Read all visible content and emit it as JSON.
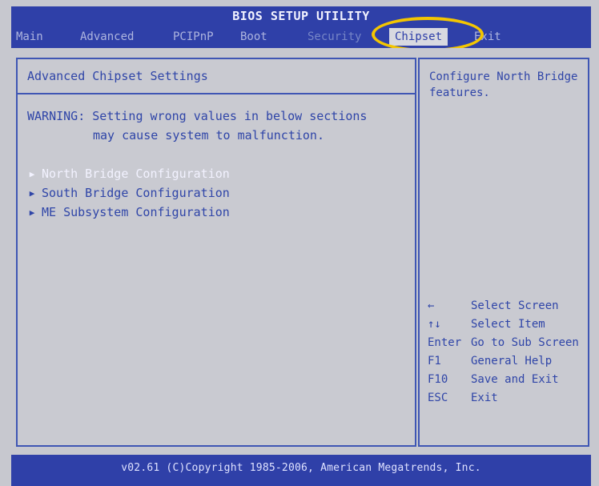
{
  "window": {
    "title": "BIOS SETUP UTILITY"
  },
  "menu": {
    "items": [
      {
        "label": "Main"
      },
      {
        "label": "Advanced"
      },
      {
        "label": "PCIPnP"
      },
      {
        "label": "Boot"
      },
      {
        "label": "Security"
      },
      {
        "label": "Chipset"
      },
      {
        "label": "Exit"
      }
    ],
    "active": "Chipset"
  },
  "main": {
    "section_title": "Advanced Chipset Settings",
    "warning_line1": "WARNING: Setting wrong values in below sections",
    "warning_line2": "may cause system to malfunction.",
    "submenus": [
      {
        "label": "North Bridge Configuration"
      },
      {
        "label": "South Bridge Configuration"
      },
      {
        "label": "ME Subsystem Configuration"
      }
    ]
  },
  "help": {
    "description": "Configure North Bridge features.",
    "keys": [
      {
        "key": "←",
        "action": "Select Screen"
      },
      {
        "key": "↑↓",
        "action": "Select Item"
      },
      {
        "key": "Enter",
        "action": "Go to Sub Screen"
      },
      {
        "key": "F1",
        "action": "General Help"
      },
      {
        "key": "F10",
        "action": "Save and Exit"
      },
      {
        "key": "ESC",
        "action": "Exit"
      }
    ]
  },
  "footer": {
    "text": "v02.61 (C)Copyright 1985-2006, American Megatrends, Inc."
  },
  "colors": {
    "bios_blue": "#2f40a8",
    "panel_gray": "#c7c8cf",
    "text_blue": "#2f45a8",
    "selected_text": "#f2f2ff",
    "annotation_yellow": "#f4c600"
  }
}
